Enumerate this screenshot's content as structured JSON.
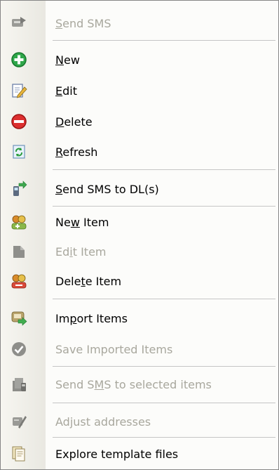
{
  "menu": {
    "items": [
      {
        "pre": "",
        "acc": "S",
        "post": "end SMS",
        "enabled": false,
        "icon": "send-sms-icon"
      },
      {
        "pre": "",
        "acc": "N",
        "post": "ew",
        "enabled": true,
        "icon": "add-circle-icon"
      },
      {
        "pre": "",
        "acc": "E",
        "post": "dit",
        "enabled": true,
        "icon": "edit-icon"
      },
      {
        "pre": "",
        "acc": "D",
        "post": "elete",
        "enabled": true,
        "icon": "delete-circle-icon"
      },
      {
        "pre": "",
        "acc": "R",
        "post": "efresh",
        "enabled": true,
        "icon": "refresh-icon"
      },
      {
        "pre": "",
        "acc": "S",
        "post": "end SMS to DL(s)",
        "enabled": true,
        "icon": "send-to-dl-icon"
      },
      {
        "pre": "Ne",
        "acc": "w",
        "post": " Item",
        "enabled": true,
        "icon": "new-item-icon"
      },
      {
        "pre": "Ed",
        "acc": "i",
        "post": "t Item",
        "enabled": false,
        "icon": "edit-item-icon"
      },
      {
        "pre": "Dele",
        "acc": "t",
        "post": "e Item",
        "enabled": true,
        "icon": "delete-item-icon"
      },
      {
        "pre": "Im",
        "acc": "p",
        "post": "ort Items",
        "enabled": true,
        "icon": "import-items-icon"
      },
      {
        "pre": "Save Imported Items",
        "acc": "",
        "post": "",
        "enabled": false,
        "icon": "checkmark-circle-icon"
      },
      {
        "pre": "Send S",
        "acc": "M",
        "post": "S to selected items",
        "enabled": false,
        "icon": "send-to-selected-icon"
      },
      {
        "pre": "Adjust addresses",
        "acc": "",
        "post": "",
        "enabled": false,
        "icon": "adjust-addresses-icon"
      },
      {
        "pre": "Explore template files",
        "acc": "",
        "post": "",
        "enabled": true,
        "icon": "explore-templates-icon"
      }
    ]
  }
}
